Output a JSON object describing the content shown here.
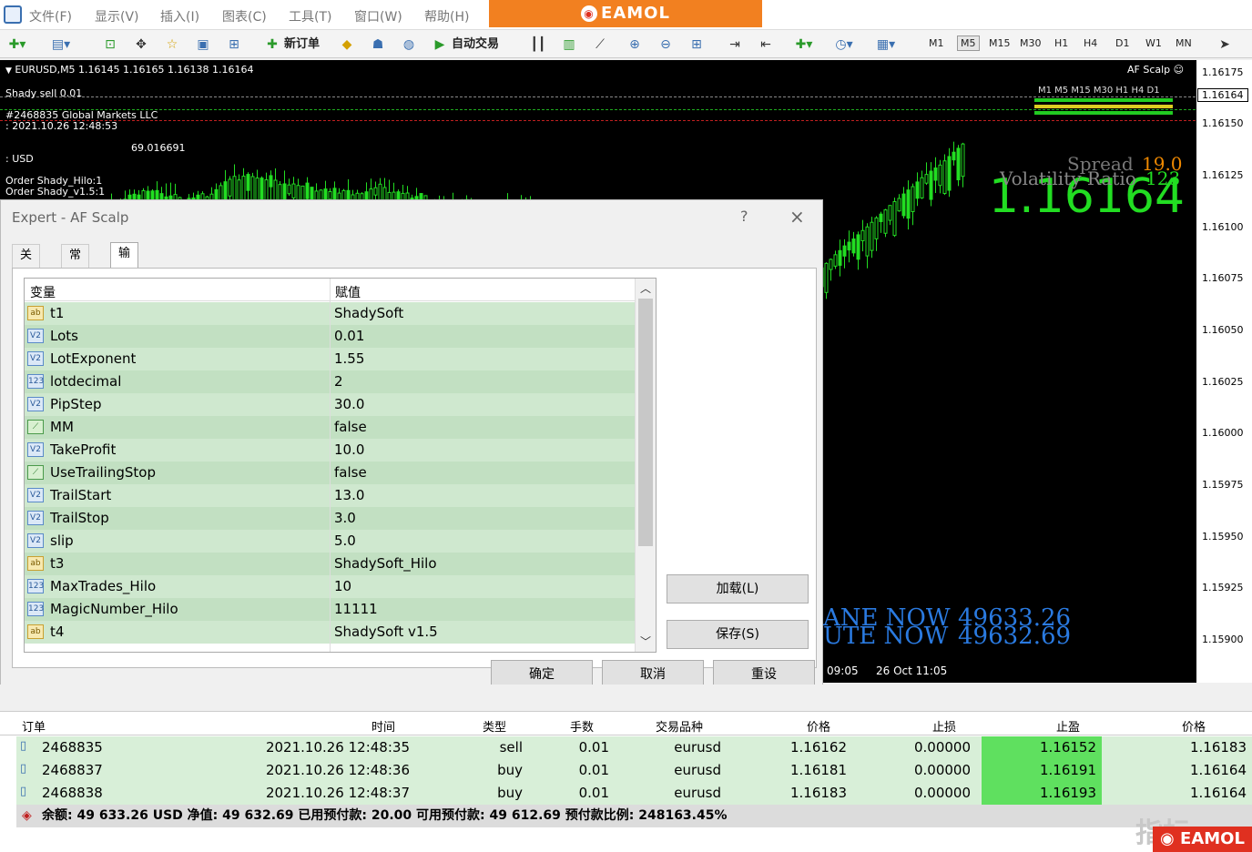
{
  "menu": [
    "文件(F)",
    "显示(V)",
    "插入(I)",
    "图表(C)",
    "工具(T)",
    "窗口(W)",
    "帮助(H)"
  ],
  "brand": "EAMOL",
  "toolbar": {
    "new_order": "新订单",
    "auto_trade": "自动交易"
  },
  "timeframes": [
    "M1",
    "M5",
    "M15",
    "M30",
    "H1",
    "H4",
    "D1",
    "W1",
    "MN"
  ],
  "active_timeframe": "M5",
  "chart": {
    "header": "EURUSD,M5  1.16145 1.16165 1.16138 1.16164",
    "ea_name": "AF Scalp",
    "overlay_lines": [
      "Shady sell 0.01",
      "#2468835 Global Markets LLC",
      ": 2021.10.26 12:48:53",
      ":  USD",
      "69.016691",
      "Order Shady_Hilo:1",
      "Order Shady_v1.5:1"
    ],
    "tf_strip": "M1 M5 M15 M30 H1 H4 D1",
    "big_price": "1.16164",
    "spread_label": "Spread",
    "spread_value": "19.0",
    "vol_label": "Volatility Ratio",
    "vol_value": "123",
    "balance_label": "ANE NOW",
    "balance_value": "49633.26",
    "equity_label": "UTE NOW",
    "equity_value": "49632.69",
    "price_ticks": [
      "1.16175",
      "1.16150",
      "1.16125",
      "1.16100",
      "1.16075",
      "1.16050",
      "1.16025",
      "1.16000",
      "1.15975",
      "1.15950",
      "1.15925",
      "1.15900"
    ],
    "current_price": "1.16164",
    "time_labels": [
      "09:05",
      "26 Oct 11:05"
    ]
  },
  "dialog": {
    "title": "Expert - AF Scalp",
    "help": "?",
    "close": "×",
    "tabs": [
      "关于",
      "常用",
      "输入参数"
    ],
    "col_var": "变量",
    "col_val": "赋值",
    "params": [
      {
        "icon": "ab",
        "name": "t1",
        "value": "ShadySoft"
      },
      {
        "icon": "V2",
        "name": "Lots",
        "value": "0.01"
      },
      {
        "icon": "V2",
        "name": "LotExponent",
        "value": "1.55"
      },
      {
        "icon": "123",
        "name": "lotdecimal",
        "value": "2"
      },
      {
        "icon": "V2",
        "name": "PipStep",
        "value": "30.0"
      },
      {
        "icon": "bool",
        "name": "MM",
        "value": "false"
      },
      {
        "icon": "V2",
        "name": "TakeProfit",
        "value": "10.0"
      },
      {
        "icon": "bool",
        "name": "UseTrailingStop",
        "value": "false"
      },
      {
        "icon": "V2",
        "name": "TrailStart",
        "value": "13.0"
      },
      {
        "icon": "V2",
        "name": "TrailStop",
        "value": "3.0"
      },
      {
        "icon": "V2",
        "name": "slip",
        "value": "5.0"
      },
      {
        "icon": "ab",
        "name": "t3",
        "value": "ShadySoft_Hilo"
      },
      {
        "icon": "123",
        "name": "MaxTrades_Hilo",
        "value": "10"
      },
      {
        "icon": "123",
        "name": "MagicNumber_Hilo",
        "value": "11111"
      },
      {
        "icon": "ab",
        "name": "t4",
        "value": "ShadySoft v1.5"
      }
    ],
    "load": "加载(L)",
    "save": "保存(S)",
    "ok": "确定",
    "cancel": "取消",
    "reset": "重设"
  },
  "terminal": {
    "headers": [
      "订单",
      "时间",
      "类型",
      "手数",
      "交易品种",
      "价格",
      "止损",
      "止盈",
      "价格"
    ],
    "orders": [
      {
        "id": "2468835",
        "time": "2021.10.26 12:48:35",
        "type": "sell",
        "lots": "0.01",
        "symbol": "eurusd",
        "price": "1.16162",
        "sl": "0.00000",
        "tp": "1.16152",
        "cur": "1.16183"
      },
      {
        "id": "2468837",
        "time": "2021.10.26 12:48:36",
        "type": "buy",
        "lots": "0.01",
        "symbol": "eurusd",
        "price": "1.16181",
        "sl": "0.00000",
        "tp": "1.16191",
        "cur": "1.16164"
      },
      {
        "id": "2468838",
        "time": "2021.10.26 12:48:37",
        "type": "buy",
        "lots": "0.01",
        "symbol": "eurusd",
        "price": "1.16183",
        "sl": "0.00000",
        "tp": "1.16193",
        "cur": "1.16164"
      }
    ],
    "summary": "余额: 49 633.26 USD  净值: 49 632.69  已用预付款: 20.00  可用预付款: 49 612.69  预付款比例: 248163.45%"
  },
  "watermark": "指标"
}
